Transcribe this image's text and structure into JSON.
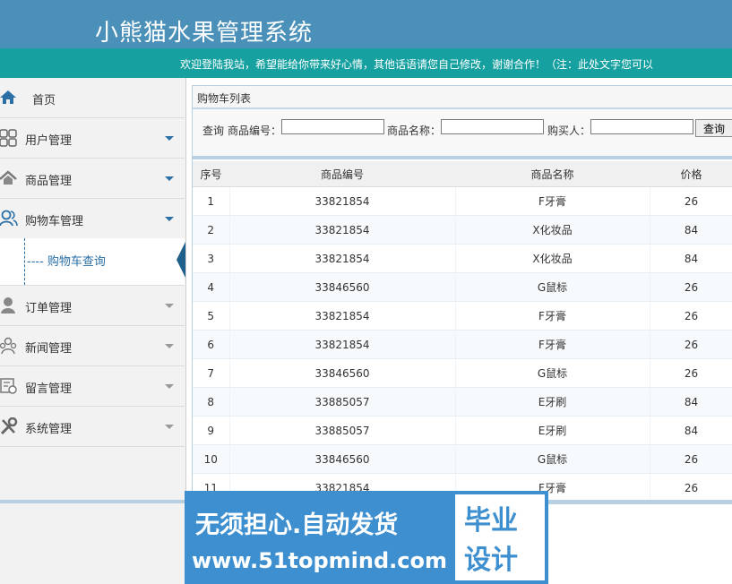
{
  "header": {
    "app_title": "小熊猫水果管理系统",
    "marquee": "欢迎登陆我站，希望能给你带来好心情，其他话语请您自己修改，谢谢合作！（注：此处文字您可以"
  },
  "sidebar": {
    "home": "首页",
    "items": [
      {
        "label": "用户管理",
        "icon": "grid-icon"
      },
      {
        "label": "商品管理",
        "icon": "house-icon"
      },
      {
        "label": "购物车管理",
        "icon": "users-icon"
      },
      {
        "label": "订单管理",
        "icon": "person-icon"
      },
      {
        "label": "新闻管理",
        "icon": "group-icon"
      },
      {
        "label": "留言管理",
        "icon": "message-icon"
      },
      {
        "label": "系统管理",
        "icon": "tools-icon"
      }
    ],
    "submenu": {
      "label": "购物车查询",
      "prefix": "----"
    }
  },
  "panel": {
    "title": "购物车列表",
    "search": {
      "label": "查询",
      "field1_label": "商品编号：",
      "field1_value": "",
      "field2_label": "商品名称：",
      "field2_value": "",
      "field3_label": "购买人：",
      "field3_value": "",
      "button": "查询"
    },
    "table": {
      "columns": [
        "序号",
        "商品编号",
        "商品名称",
        "价格"
      ],
      "rows": [
        [
          "1",
          "33821854",
          "F牙膏",
          "26"
        ],
        [
          "2",
          "33821854",
          "X化妆品",
          "84"
        ],
        [
          "3",
          "33821854",
          "X化妆品",
          "84"
        ],
        [
          "4",
          "33846560",
          "G鼠标",
          "26"
        ],
        [
          "5",
          "33821854",
          "F牙膏",
          "26"
        ],
        [
          "6",
          "33821854",
          "F牙膏",
          "26"
        ],
        [
          "7",
          "33846560",
          "G鼠标",
          "26"
        ],
        [
          "8",
          "33885057",
          "E牙刷",
          "84"
        ],
        [
          "9",
          "33885057",
          "E牙刷",
          "84"
        ],
        [
          "10",
          "33846560",
          "G鼠标",
          "26"
        ],
        [
          "11",
          "33821854",
          "F牙膏",
          "26"
        ]
      ]
    }
  },
  "watermark": {
    "line1": "无须担心.自动发货",
    "line2": "www.51topmind.com",
    "badge_top": "毕业",
    "badge_bottom": "设计"
  },
  "colors": {
    "header": "#4a90b8",
    "marquee": "#17a0a0",
    "accent": "#2a6fa6",
    "watermark": "#3d8fcf"
  }
}
